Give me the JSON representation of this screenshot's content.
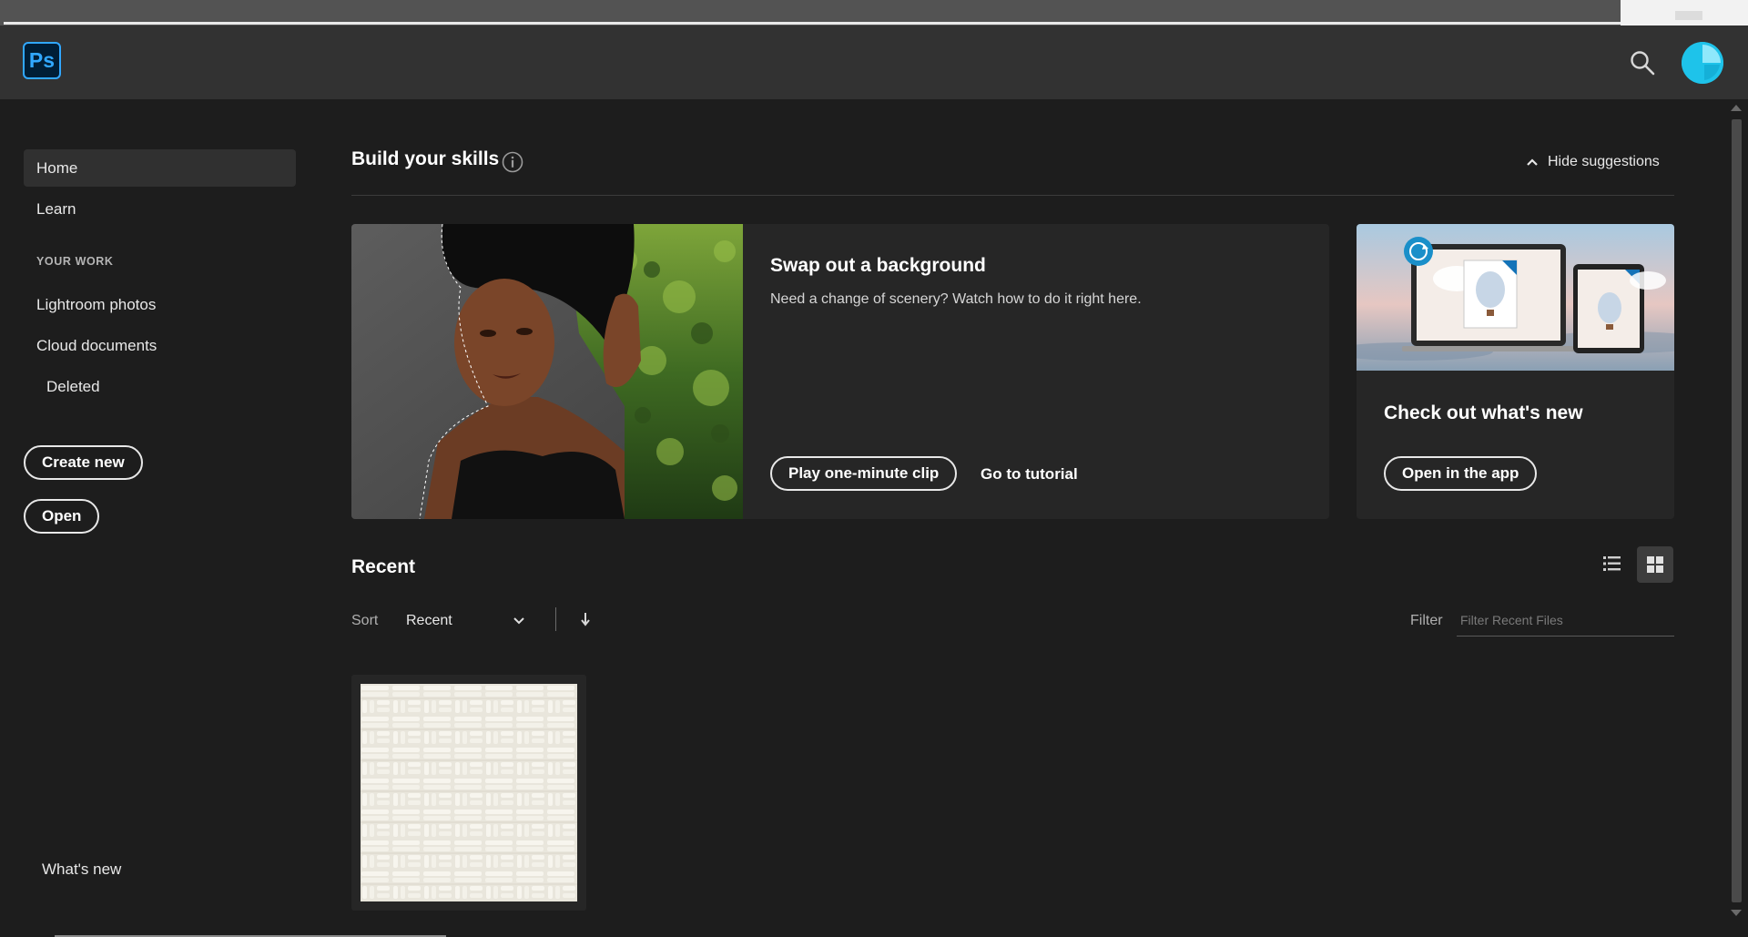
{
  "app": {
    "logo_text": "Ps"
  },
  "sidebar": {
    "home": "Home",
    "learn": "Learn",
    "section_label": "YOUR WORK",
    "lightroom": "Lightroom photos",
    "cloud_docs": "Cloud documents",
    "deleted": "Deleted",
    "create_new": "Create new",
    "open": "Open",
    "whats_new": "What's new"
  },
  "skills": {
    "title": "Build your skills",
    "hide_label": "Hide suggestions",
    "card": {
      "title": "Swap out a background",
      "description": "Need a change of scenery? Watch how to do it right here.",
      "play_label": "Play one-minute clip",
      "tutorial_label": "Go to tutorial"
    },
    "new_card": {
      "title": "Check out what's new",
      "button_label": "Open in the app"
    }
  },
  "recent": {
    "title": "Recent",
    "sort_label": "Sort",
    "sort_value": "Recent",
    "filter_label": "Filter",
    "filter_placeholder": "Filter Recent Files"
  },
  "colors": {
    "ps_blue": "#31a8ff",
    "avatar": "#1ec3ea",
    "background": "#1d1d1d",
    "header": "#323232"
  },
  "icons": [
    "search-icon",
    "avatar",
    "info-icon",
    "chevron-up-icon",
    "chevron-down-icon",
    "arrow-down-icon",
    "list-view-icon",
    "grid-view-icon",
    "sync-icon"
  ]
}
